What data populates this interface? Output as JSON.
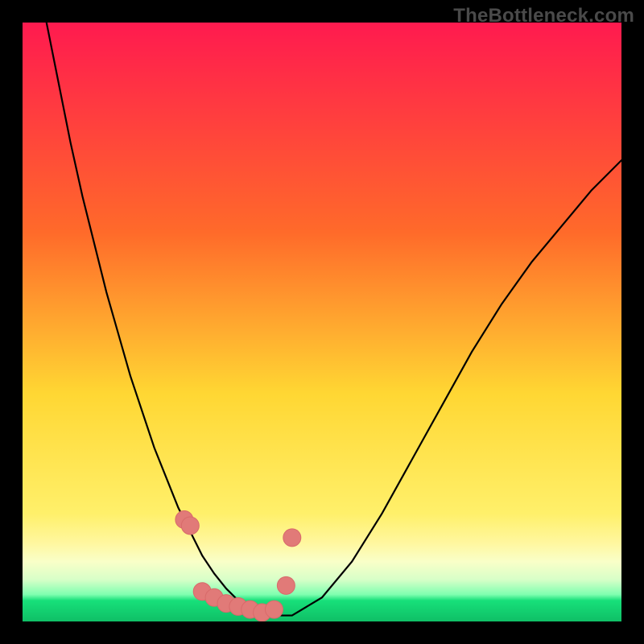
{
  "watermark": "TheBottleneck.com",
  "colors": {
    "frame": "#000000",
    "gradient_top": "#ff1a4f",
    "gradient_mid1": "#ff6a2a",
    "gradient_mid2": "#ffd733",
    "gradient_band1": "#fff7a0",
    "gradient_band2": "#f9ffc8",
    "gradient_band3": "#d8ffc8",
    "gradient_green": "#17e07a",
    "gradient_green_dark": "#0fbf66",
    "curve": "#000000",
    "marker_fill": "#e17a78",
    "marker_stroke": "#d86a6a"
  },
  "chart_data": {
    "type": "line",
    "title": "",
    "xlabel": "",
    "ylabel": "",
    "xlim": [
      0,
      100
    ],
    "ylim": [
      0,
      100
    ],
    "series": [
      {
        "name": "bottleneck-curve",
        "x": [
          4,
          6,
          8,
          10,
          12,
          14,
          16,
          18,
          20,
          22,
          24,
          26,
          28,
          30,
          32,
          34,
          36,
          38,
          40,
          45,
          50,
          55,
          60,
          65,
          70,
          75,
          80,
          85,
          90,
          95,
          100
        ],
        "y": [
          100,
          90,
          80,
          71,
          63,
          55,
          48,
          41,
          35,
          29,
          24,
          19,
          15,
          11,
          8,
          5.5,
          3.5,
          2,
          1,
          1,
          4,
          10,
          18,
          27,
          36,
          45,
          53,
          60,
          66,
          72,
          77
        ]
      }
    ],
    "markers": {
      "name": "highlight-points",
      "x": [
        27,
        28,
        30,
        32,
        34,
        36,
        38,
        40,
        42,
        44,
        45
      ],
      "y": [
        17,
        16,
        5,
        4,
        3,
        2.5,
        2,
        1.5,
        2,
        6,
        14
      ]
    },
    "green_band_y_range": [
      0,
      4
    ],
    "pale_band_y_range": [
      4,
      14
    ]
  }
}
